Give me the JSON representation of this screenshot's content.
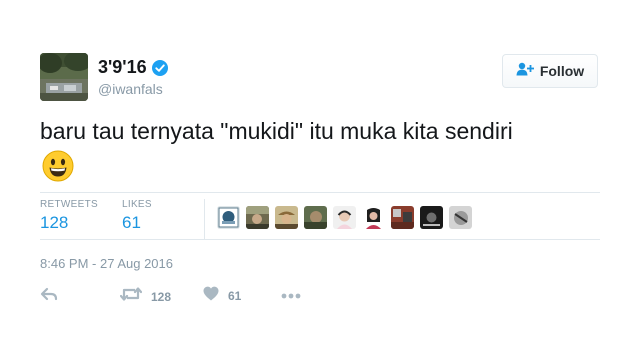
{
  "author": {
    "display_name": "3'9'16",
    "username": "@iwanfals",
    "verified": true,
    "avatar_icon": "avatar-photo"
  },
  "follow_button": {
    "label": "Follow",
    "icon": "add-user-icon"
  },
  "tweet": {
    "text": "baru tau ternyata \"mukidi\" itu muka kita sendiri",
    "emoji": "grinning-face"
  },
  "stats": {
    "retweets_label": "RETWEETS",
    "retweets_count": "128",
    "likes_label": "LIKES",
    "likes_count": "61"
  },
  "timestamp": "8:46 PM - 27 Aug 2016",
  "actions": {
    "retweet_count": "128",
    "like_count": "61"
  },
  "colors": {
    "link_blue": "#1b95e0",
    "muted_gray": "#8899a6",
    "verified_blue": "#1da1f2",
    "divider": "#e1e8ed"
  }
}
